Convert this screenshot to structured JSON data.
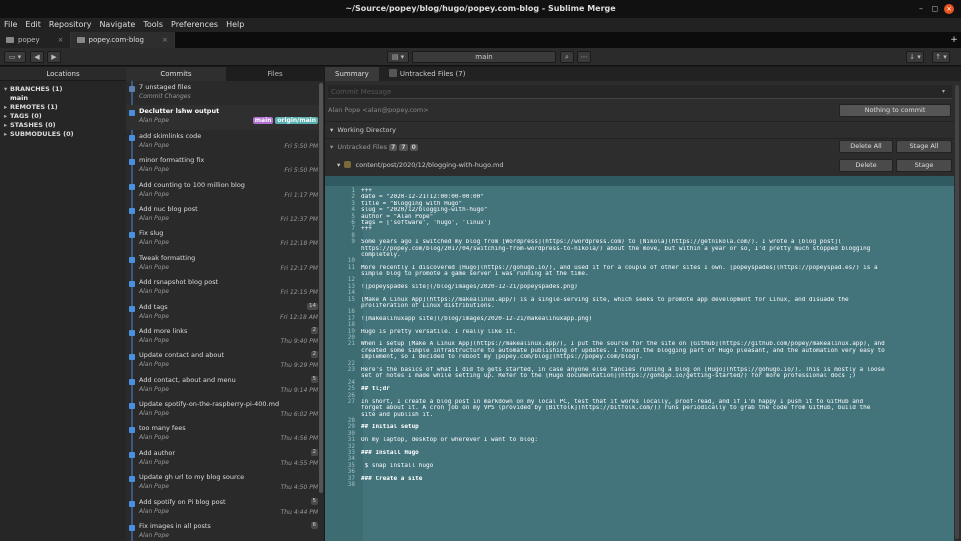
{
  "window": {
    "title": "~/Source/popey/blog/hugo/popey.com-blog - Sublime Merge",
    "min": "–",
    "max": "◻",
    "close": "×"
  },
  "menu": [
    "File",
    "Edit",
    "Repository",
    "Navigate",
    "Tools",
    "Preferences",
    "Help"
  ],
  "tabs": [
    {
      "label": "popey",
      "close": "×"
    },
    {
      "label": "popey.com-blog",
      "close": "×"
    }
  ],
  "tab_add": "+",
  "toolbar": {
    "branch": "main"
  },
  "sidebar": {
    "header": "Locations",
    "branches": "BRANCHES (1)",
    "branch_main": "main",
    "remotes": "REMOTES (1)",
    "tags": "TAGS (0)",
    "stashes": "STASHES (0)",
    "submodules": "SUBMODULES (0)"
  },
  "commit_tabs": {
    "commits": "Commits",
    "files": "Files"
  },
  "commits": [
    {
      "msg": "7 unstaged files",
      "author": "Commit Changes",
      "time": "",
      "count": ""
    },
    {
      "msg": "Declutter lshw output",
      "author": "Alan Pope",
      "time": "",
      "count": "",
      "bold": true
    },
    {
      "msg": "add skimlinks code",
      "author": "Alan Pope",
      "time": "Fri 5:50 PM",
      "count": ""
    },
    {
      "msg": "minor formatting fix",
      "author": "Alan Pope",
      "time": "Fri 5:50 PM",
      "count": ""
    },
    {
      "msg": "Add counting to 100 million blog",
      "author": "Alan Pope",
      "time": "Fri 1:17 PM",
      "count": ""
    },
    {
      "msg": "Add nuc blog post",
      "author": "Alan Pope",
      "time": "Fri 12:37 PM",
      "count": ""
    },
    {
      "msg": "Fix slug",
      "author": "Alan Pope",
      "time": "Fri 12:18 PM",
      "count": ""
    },
    {
      "msg": "Tweak formatting",
      "author": "Alan Pope",
      "time": "Fri 12:17 PM",
      "count": ""
    },
    {
      "msg": "Add rsnapshot blog post",
      "author": "Alan Pope",
      "time": "Fri 12:15 PM",
      "count": ""
    },
    {
      "msg": "Add tags",
      "author": "Alan Pope",
      "time": "Fri 12:18 AM",
      "count": "14"
    },
    {
      "msg": "Add more links",
      "author": "Alan Pope",
      "time": "Thu 9:40 PM",
      "count": "2"
    },
    {
      "msg": "Update contact and about",
      "author": "Alan Pope",
      "time": "Thu 9:29 PM",
      "count": "2"
    },
    {
      "msg": "Add contact, about and menu",
      "author": "Alan Pope",
      "time": "Thu 9:14 PM",
      "count": "5"
    },
    {
      "msg": "Update spotify-on-the-raspberry-pi-400.md",
      "author": "Alan Pope",
      "time": "Thu 6:02 PM",
      "count": ""
    },
    {
      "msg": "too many fees",
      "author": "Alan Pope",
      "time": "Thu 4:56 PM",
      "count": ""
    },
    {
      "msg": "Add author",
      "author": "Alan Pope",
      "time": "Thu 4:55 PM",
      "count": "2"
    },
    {
      "msg": "Update gh url to my blog source",
      "author": "Alan Pope",
      "time": "Thu 4:50 PM",
      "count": ""
    },
    {
      "msg": "Add spotify on Pi blog post",
      "author": "Alan Pope",
      "time": "Thu 4:44 PM",
      "count": "5"
    },
    {
      "msg": "Fix images in all posts",
      "author": "Alan Pope",
      "time": "",
      "count": "6"
    }
  ],
  "badges": {
    "main": "main",
    "origin": "origin/main"
  },
  "summary": {
    "tab_summary": "Summary",
    "tab_untracked": "Untracked Files (7)",
    "commit_placeholder": "Commit Message",
    "author": "Alan Pope <alan@popey.com>",
    "nothing_to_commit": "Nothing to commit",
    "working_directory": "Working Directory",
    "untracked_files": "Untracked Files",
    "untracked_counts": [
      "7",
      "7",
      "0"
    ],
    "delete_all": "Delete All",
    "stage_all": "Stage All",
    "file_path": "content/post/2020/12/blogging-with-hugo.md",
    "delete": "Delete",
    "stage": "Stage"
  },
  "diff_lines": [
    [
      "1",
      "+++"
    ],
    [
      "2",
      "date = \"2020-12-21T12:00:00-00:00\""
    ],
    [
      "3",
      "title = \"Blogging with Hugo\""
    ],
    [
      "4",
      "slug = \"2020/12/blogging-with-hugo\""
    ],
    [
      "5",
      "author = \"Alan Pope\""
    ],
    [
      "6",
      "tags = ['software', 'hugo', 'linux']"
    ],
    [
      "7",
      "+++"
    ],
    [
      "8",
      ""
    ],
    [
      "9",
      "Some years ago I switched my blog from [Wordpress](https://wordpress.com) to [Nikola](https://getnikola.com/). I wrote a [blog post]("
    ],
    [
      "",
      "https://popey.com/blog/2017/04/switching-from-wordpress-to-nikola/) about the move, but within a year or so, I'd pretty much stopped blogging"
    ],
    [
      "",
      "completely."
    ],
    [
      "10",
      ""
    ],
    [
      "11",
      "More recently I discovered [Hugo](https://gohugo.io/), and used it for a couple of other sites I own. [popeyspades](https://popeyspad.es/) is a"
    ],
    [
      "",
      "simple blog to promote a game server I was running at the time."
    ],
    [
      "12",
      ""
    ],
    [
      "13",
      "![popeyspades site](/blog/images/2020-12-21/popeyspades.png)"
    ],
    [
      "14",
      ""
    ],
    [
      "15",
      "[Make A Linux App](https://makealinux.app/) is a single-serving site, which seeks to promote app development for Linux, and disuade the"
    ],
    [
      "",
      "proliferation of Linux distributions."
    ],
    [
      "16",
      ""
    ],
    [
      "17",
      "![makealinuxapp site](/blog/images/2020-12-21/makealinuxapp.png)"
    ],
    [
      "18",
      ""
    ],
    [
      "19",
      "Hugo is pretty versatile. I really like it."
    ],
    [
      "20",
      ""
    ],
    [
      "21",
      "When I setup [Make A Linux App](https://makealinux.app/), I put the source for the site on [GitHub](https://github.com/popey/makealinux.app), and"
    ],
    [
      "",
      "created some simple infrastructure to automate publishing of updates. I found the blogging part of Hugo pleasant, and the automation very easy to"
    ],
    [
      "",
      "implement, so I decided to reboot my [popey.com/blog](https://popey.com/blog)."
    ],
    [
      "22",
      ""
    ],
    [
      "23",
      "Here's the basics of what I did to gets started, in case anyone else fancies running a blog on [Hugo](https://gohugo.io/). This is mostly a loose"
    ],
    [
      "",
      "set of notes I made while setting up. Refer to the [Hugo documentation](https://gohugo.io/getting-started/) for more professional docs ;)"
    ],
    [
      "24",
      ""
    ],
    [
      "25",
      "## tl;dr"
    ],
    [
      "26",
      ""
    ],
    [
      "27",
      "In short, I create a blog post in markdown on my local PC, test that it works locally, proof-read, and if I'm happy I push it to GitHub and"
    ],
    [
      "",
      "forget about it. A cron job on my VPS (provided by [Bitfolk](https://bitfolk.com/)) runs periodically to grab the code from GitHub, build the"
    ],
    [
      "",
      "site and publish it."
    ],
    [
      "28",
      ""
    ],
    [
      "29",
      "## Initial setup"
    ],
    [
      "30",
      ""
    ],
    [
      "31",
      "On my laptop, desktop or wherever I want to blog:"
    ],
    [
      "32",
      ""
    ],
    [
      "33",
      "### Install Hugo"
    ],
    [
      "34",
      ""
    ],
    [
      "35",
      "`$ snap install hugo`"
    ],
    [
      "36",
      ""
    ],
    [
      "37",
      "### Create a site"
    ],
    [
      "38",
      ""
    ]
  ]
}
